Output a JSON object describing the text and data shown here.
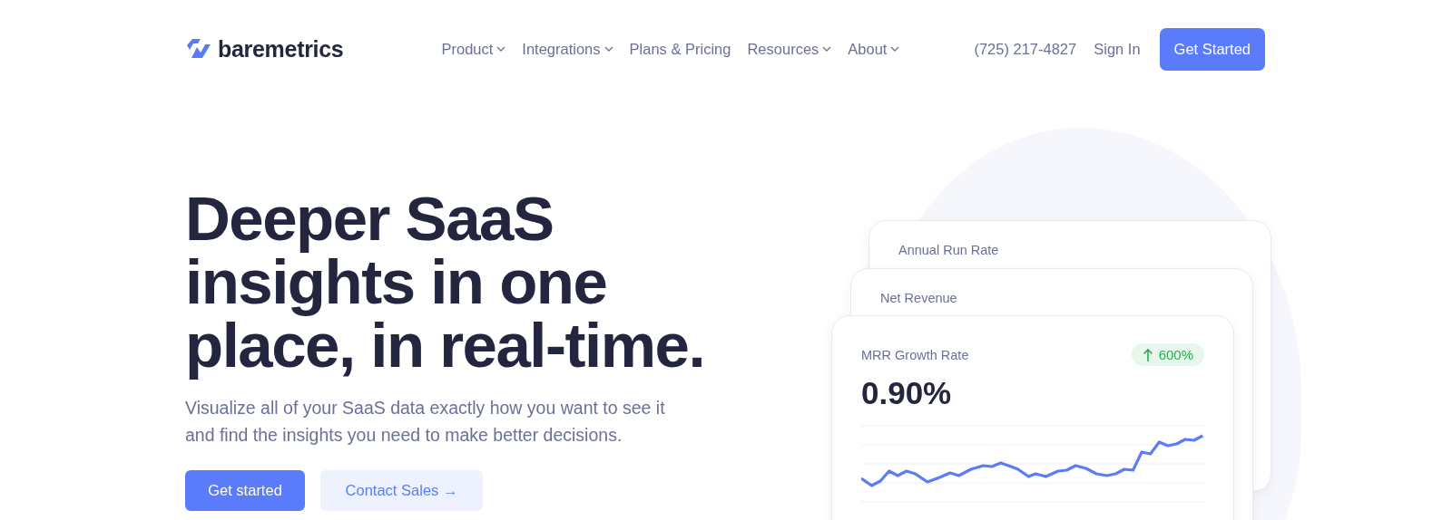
{
  "header": {
    "logo": "baremetrics",
    "nav": [
      {
        "label": "Product",
        "has_menu": true
      },
      {
        "label": "Integrations",
        "has_menu": true
      },
      {
        "label": "Plans & Pricing",
        "has_menu": false
      },
      {
        "label": "Resources",
        "has_menu": true
      },
      {
        "label": "About",
        "has_menu": true
      }
    ],
    "phone": "(725) 217-4827",
    "sign_in": "Sign In",
    "cta": "Get Started"
  },
  "hero": {
    "heading": "Deeper SaaS insights in one place, in real-time.",
    "subtitle": "Visualize all of your SaaS data exactly how you want to see it and find the insights you need to make better decisions.",
    "primary_button": "Get started",
    "secondary_button": "Contact Sales →"
  },
  "cards": [
    {
      "title": "Annual Run Rate"
    },
    {
      "title": "Net Revenue"
    },
    {
      "title": "MRR Growth Rate",
      "value": "0.90%",
      "change": "600%",
      "rising": true
    }
  ]
}
